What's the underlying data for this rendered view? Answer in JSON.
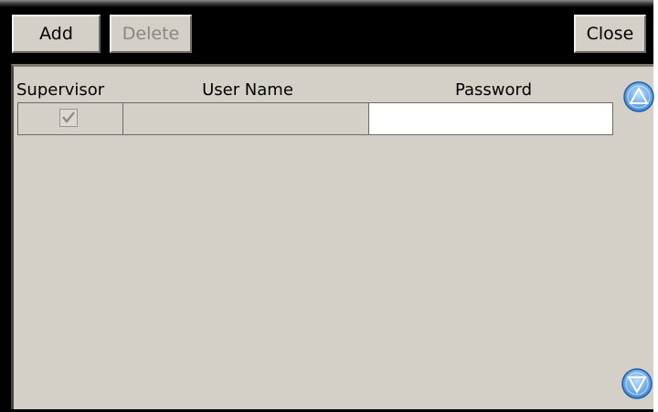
{
  "toolbar": {
    "add_label": "Add",
    "delete_label": "Delete",
    "close_label": "Close"
  },
  "grid": {
    "columns": [
      "Supervisor",
      "User Name",
      "Password"
    ],
    "rows": [
      {
        "supervisor": true,
        "user_name": "",
        "password": ""
      }
    ]
  },
  "scroll": {
    "up_icon": "scroll-up-arrow-icon",
    "down_icon": "scroll-down-arrow-icon"
  },
  "colors": {
    "toolbar_bg": "#000000",
    "panel_bg": "#d4d0c8",
    "scroll_accent": "#3e8ad6"
  }
}
